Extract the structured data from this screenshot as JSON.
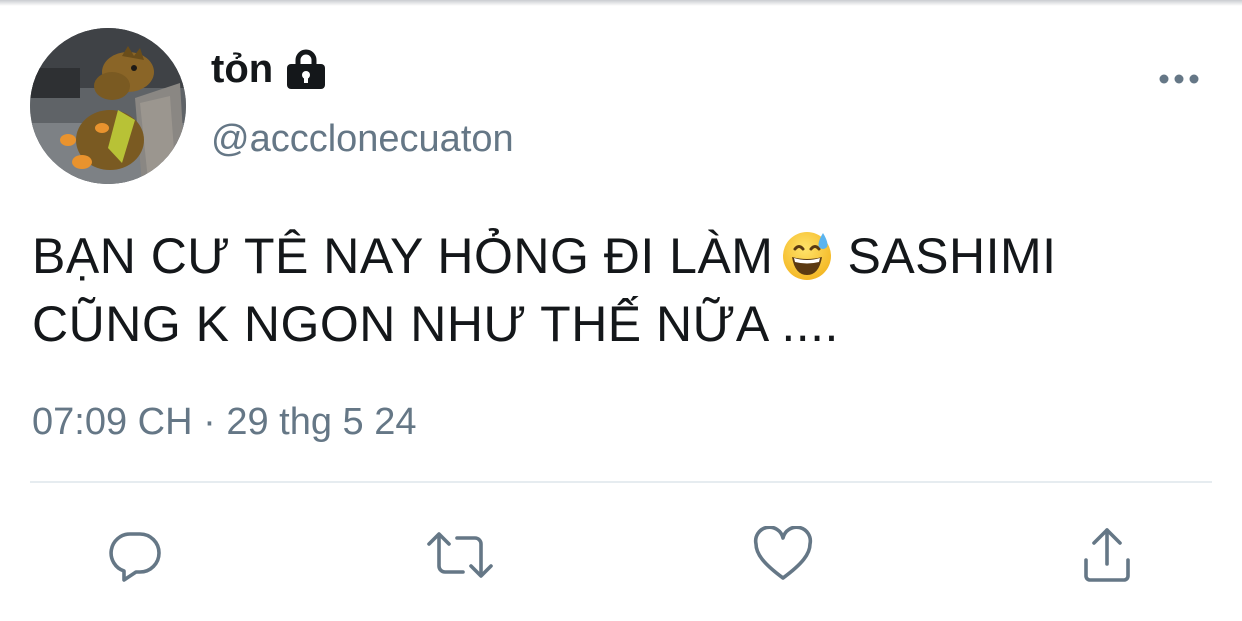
{
  "user": {
    "display_name": "tỏn",
    "username": "@accclonecuaton",
    "protected_icon": "lock-icon",
    "avatar": "stuffed-dinosaur-toy-photo"
  },
  "tweet": {
    "text_part1": "BẠN CƯ TÊ NAY HỎNG ĐI LÀM",
    "emoji": "grinning-face-with-sweat",
    "text_part2": "SASHIMI CŨNG K NGON NHƯ THẾ NỮA ....",
    "time": "07:09 CH",
    "separator": "·",
    "date": "29 thg 5 24"
  },
  "actions": [
    {
      "name": "reply",
      "icon": "reply-bubble-icon"
    },
    {
      "name": "retweet",
      "icon": "retweet-icon"
    },
    {
      "name": "like",
      "icon": "heart-icon"
    },
    {
      "name": "share",
      "icon": "share-upload-icon"
    }
  ],
  "colors": {
    "text": "#14171a",
    "secondary": "#657786",
    "divider": "#e6ecf0",
    "icon": "#657786"
  }
}
